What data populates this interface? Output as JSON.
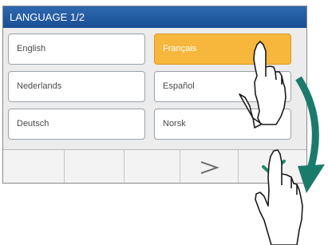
{
  "header": {
    "title": "LANGUAGE  1/2"
  },
  "languages": [
    {
      "label": "English",
      "selected": false
    },
    {
      "label": "Français",
      "selected": true
    },
    {
      "label": "Nederlands",
      "selected": false
    },
    {
      "label": "Español",
      "selected": false
    },
    {
      "label": "Deutsch",
      "selected": false
    },
    {
      "label": "Norsk",
      "selected": false
    }
  ],
  "toolbar": {
    "next_icon": "chevron-right-icon",
    "confirm_icon": "checkmark-icon"
  },
  "colors": {
    "title_bar": "#1f579c",
    "selected_button": "#f6b73c",
    "checkmark": "#1d8a6e",
    "arrow": "#1b7b6a"
  }
}
